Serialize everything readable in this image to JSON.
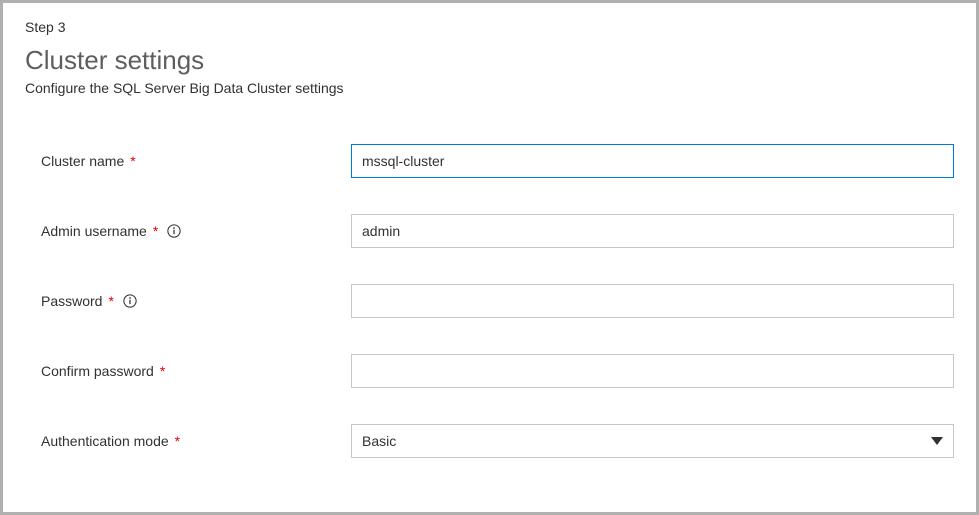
{
  "step": "Step 3",
  "title": "Cluster settings",
  "subtitle": "Configure the SQL Server Big Data Cluster settings",
  "fields": {
    "cluster_name": {
      "label": "Cluster name",
      "value": "mssql-cluster"
    },
    "admin_username": {
      "label": "Admin username",
      "value": "admin"
    },
    "password": {
      "label": "Password",
      "value": ""
    },
    "confirm_password": {
      "label": "Confirm password",
      "value": ""
    },
    "auth_mode": {
      "label": "Authentication mode",
      "value": "Basic"
    }
  }
}
